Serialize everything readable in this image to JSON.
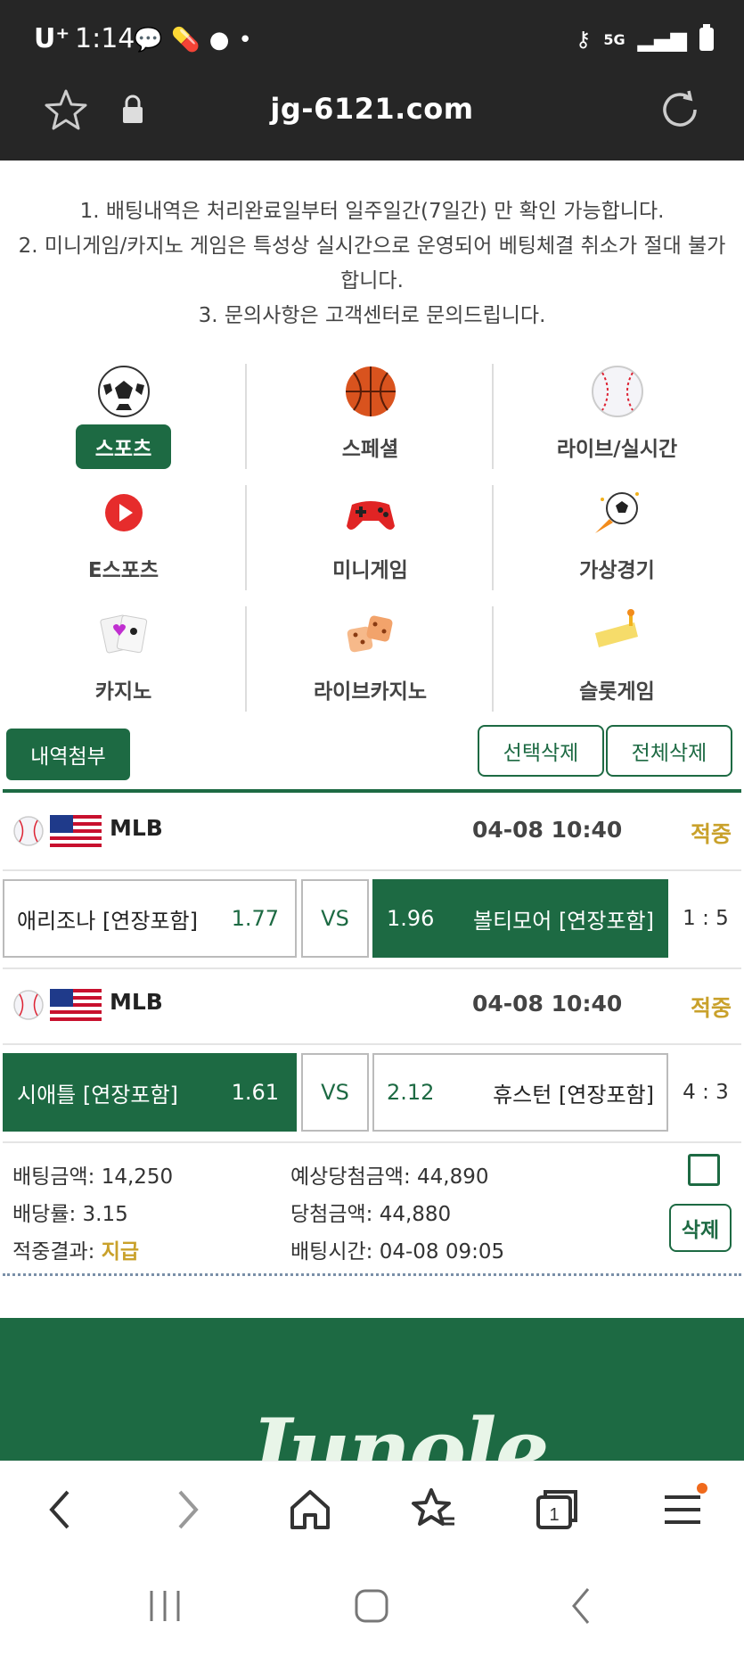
{
  "status_bar": {
    "carrier": "U⁺",
    "time": "1:14",
    "network": "5G"
  },
  "browser": {
    "url": "jg-6121.com"
  },
  "notices": [
    "1. 배팅내역은 처리완료일부터 일주일간(7일간) 만 확인 가능합니다.",
    "2. 미니게임/카지노 게임은 특성상 실시간으로 운영되어 베팅체결 취소가 절대 불가합니다.",
    "3. 문의사항은 고객센터로 문의드립니다."
  ],
  "categories": [
    {
      "label": "스포츠",
      "icon": "soccer-ball-icon",
      "active": true
    },
    {
      "label": "스페셜",
      "icon": "basketball-icon",
      "active": false
    },
    {
      "label": "라이브/실시간",
      "icon": "baseball-icon",
      "active": false
    },
    {
      "label": "E스포츠",
      "icon": "play-icon",
      "active": false
    },
    {
      "label": "미니게임",
      "icon": "gamepad-icon",
      "active": false
    },
    {
      "label": "가상경기",
      "icon": "rocket-ball-icon",
      "active": false
    },
    {
      "label": "카지노",
      "icon": "cards-icon",
      "active": false
    },
    {
      "label": "라이브카지노",
      "icon": "dice-icon",
      "active": false
    },
    {
      "label": "슬롯게임",
      "icon": "slot-icon",
      "active": false
    }
  ],
  "actions": {
    "attach": "내역첨부",
    "delete_selected": "선택삭제",
    "delete_all": "전체삭제"
  },
  "bets": [
    {
      "league": "MLB",
      "datetime": "04-08 10:40",
      "result": "적중",
      "home_team": "애리조나 [연장포함]",
      "home_odds": "1.77",
      "vs": "VS",
      "away_odds": "1.96",
      "away_team": "볼티모어 [연장포함]",
      "selected": "away",
      "score": "1 : 5"
    },
    {
      "league": "MLB",
      "datetime": "04-08 10:40",
      "result": "적중",
      "home_team": "시애틀 [연장포함]",
      "home_odds": "1.61",
      "vs": "VS",
      "away_odds": "2.12",
      "away_team": "휴스턴 [연장포함]",
      "selected": "home",
      "score": "4 : 3"
    }
  ],
  "summary": {
    "bet_amount_label": "배팅금액:",
    "bet_amount": "14,250",
    "odds_label": "배당률:",
    "odds": "3.15",
    "result_label": "적중결과:",
    "result": "지급",
    "expected_label": "예상당첨금액:",
    "expected": "44,890",
    "win_label": "당첨금액:",
    "win": "44,880",
    "time_label": "배팅시간:",
    "time": "04-08 09:05",
    "delete_button": "삭제"
  },
  "banner": {
    "logo_text": "Junole"
  },
  "colors": {
    "brand_green": "#1d6a43",
    "gold": "#c9a12b",
    "topbar": "#262626"
  }
}
